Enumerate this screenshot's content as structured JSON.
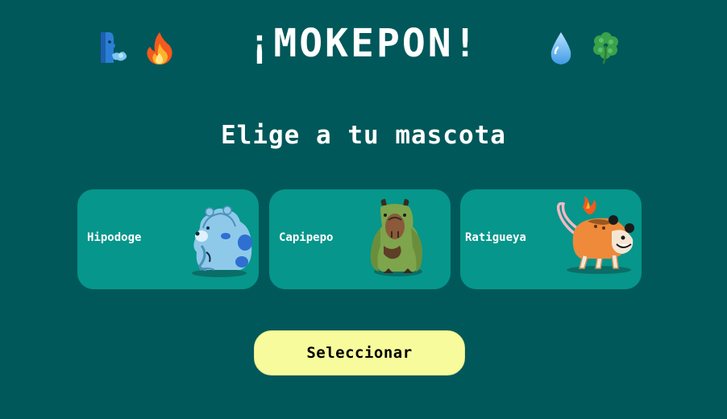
{
  "header": {
    "title": "¡MOKEPON!",
    "icons": [
      "wind-icon",
      "fire-icon",
      "water-drop-icon",
      "clover-icon"
    ]
  },
  "subtitle": "Elige a tu mascota",
  "pets": [
    {
      "name": "Hipodoge",
      "icon": "hipodoge-icon"
    },
    {
      "name": "Capipepo",
      "icon": "capipepo-icon"
    },
    {
      "name": "Ratigueya",
      "icon": "ratigueya-icon"
    }
  ],
  "select_button": {
    "label": "Seleccionar"
  },
  "colors": {
    "background": "#00585a",
    "card": "#06968b",
    "button": "#f7fb9c",
    "text": "#ffffff"
  }
}
